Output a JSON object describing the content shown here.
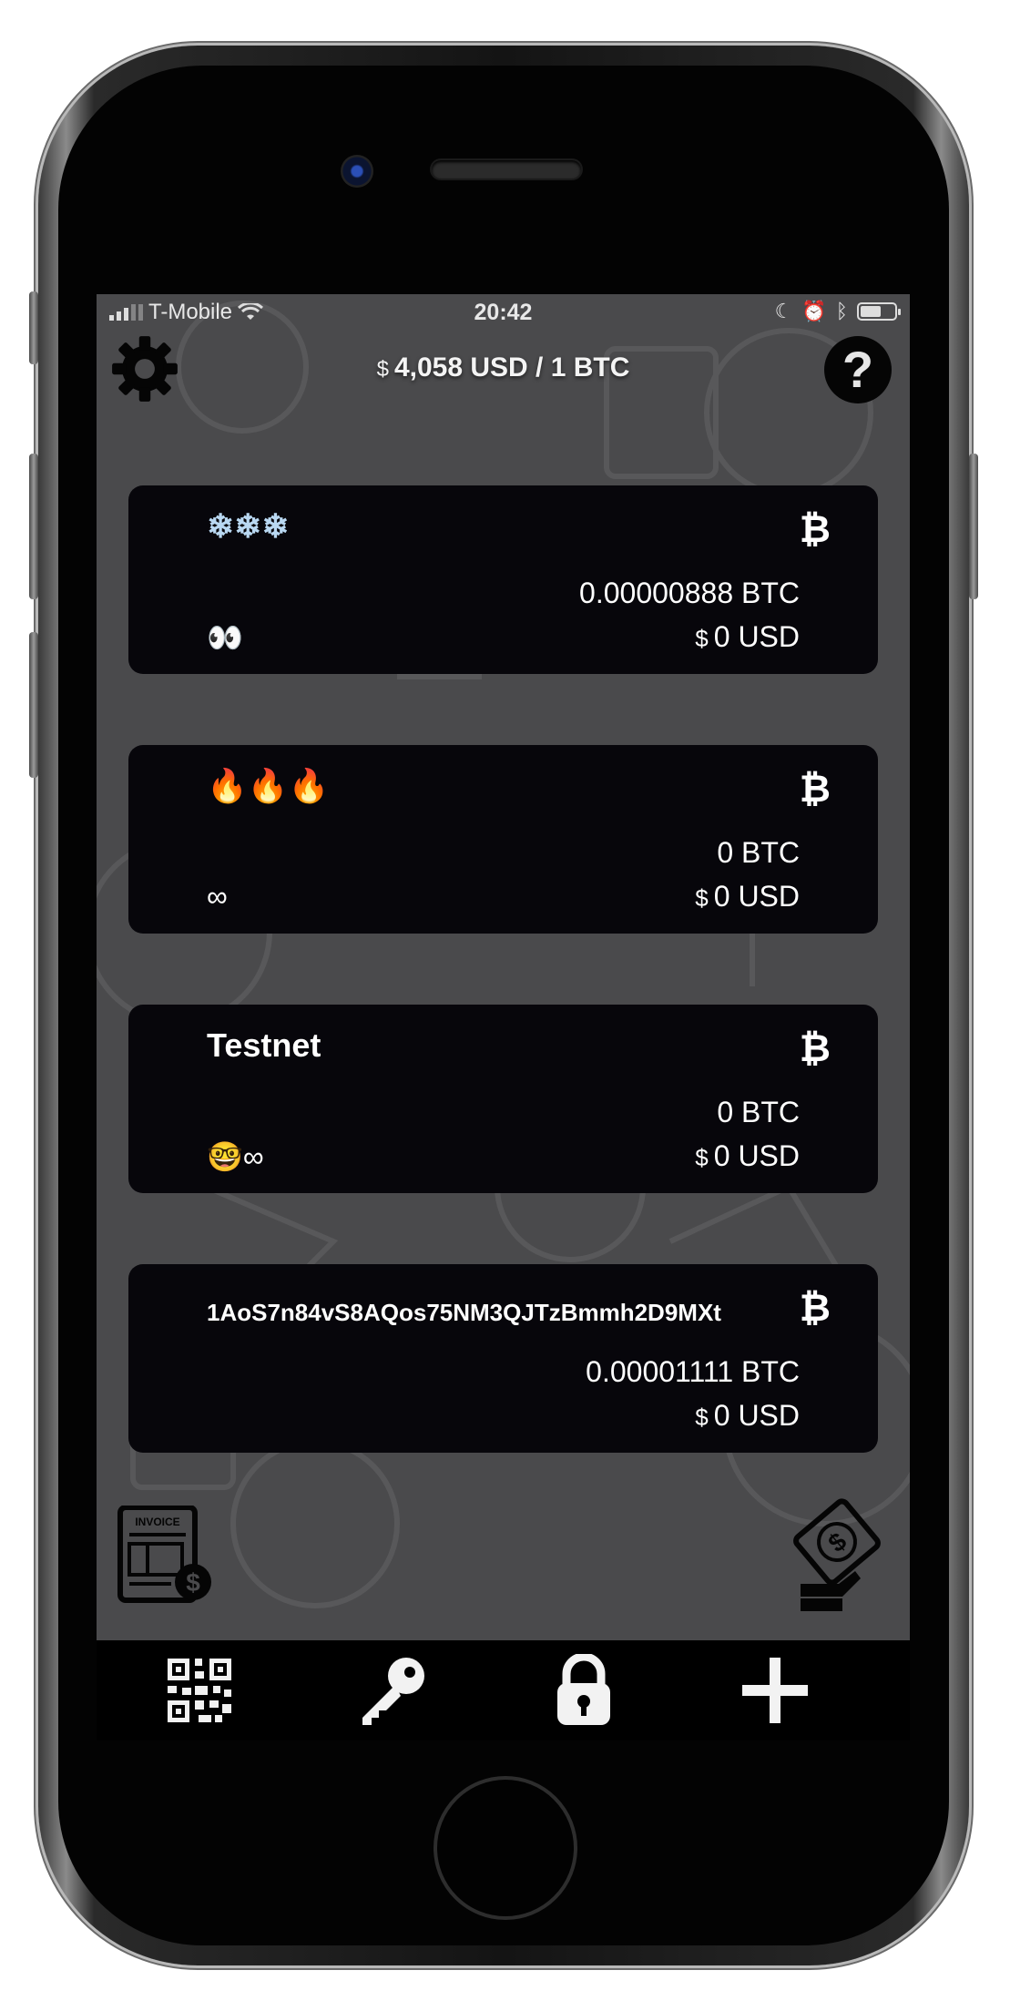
{
  "status_bar": {
    "carrier": "T-Mobile",
    "time": "20:42",
    "wifi_icon": "wifi-icon",
    "moon_icon": "moon-icon",
    "alarm_icon": "alarm-icon",
    "bluetooth_icon": "bluetooth-icon",
    "battery_icon": "battery-icon"
  },
  "header": {
    "settings_icon": "gear-icon",
    "help_icon": "question-icon",
    "help_glyph": "?",
    "rate_currency": "$",
    "rate_text": "4,058 USD / 1 BTC"
  },
  "wallets": [
    {
      "label": "❄❄❄",
      "btc_symbol": "₿",
      "btc_amount": "0.00000888 BTC",
      "usd_currency": "$",
      "usd_amount": "0 USD",
      "sub": "👀"
    },
    {
      "label": "🔥🔥🔥",
      "btc_symbol": "₿",
      "btc_amount": "0 BTC",
      "usd_currency": "$",
      "usd_amount": "0 USD",
      "sub": "∞"
    },
    {
      "label": "Testnet",
      "btc_symbol": "₿",
      "btc_amount": "0 BTC",
      "usd_currency": "$",
      "usd_amount": "0 USD",
      "sub": "🤓∞"
    },
    {
      "label": "1AoS7n84vS8AQos75NM3QJTzBmmh2D9MXt",
      "btc_symbol": "₿",
      "btc_amount": "0.00001111 BTC",
      "usd_currency": "$",
      "usd_amount": "0 USD",
      "sub": ""
    }
  ],
  "actions": {
    "invoice_icon": "invoice-icon",
    "invoice_text": "INVOICE",
    "send_money_icon": "hand-dollar-icon"
  },
  "tabbar": {
    "items": [
      {
        "name": "qr-code-icon"
      },
      {
        "name": "key-icon"
      },
      {
        "name": "lock-icon"
      },
      {
        "name": "plus-icon"
      }
    ]
  },
  "colors": {
    "screen_bg": "#4a4a4c",
    "card_bg": "#07060b",
    "tabbar_bg": "#000000",
    "text": "#ffffff"
  }
}
